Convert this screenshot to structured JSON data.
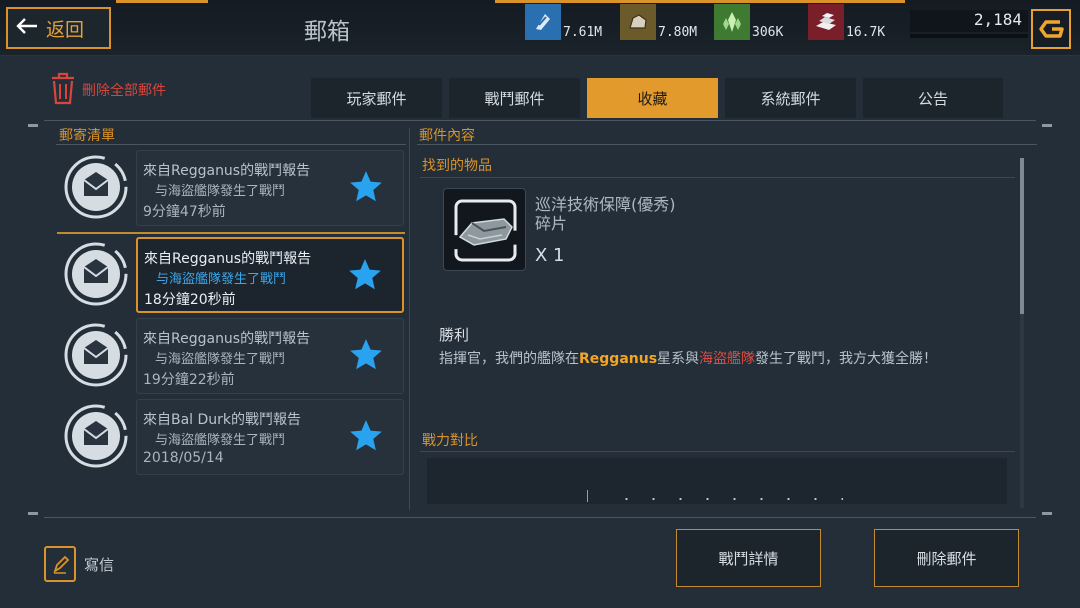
{
  "header": {
    "back_label": "返回",
    "title": "郵箱",
    "resources": [
      {
        "icon": "crystal-shard-icon",
        "value": "7.61M",
        "color": "#2a6fb0"
      },
      {
        "icon": "ore-rock-icon",
        "value": "7.80M",
        "color": "#6b5a2a"
      },
      {
        "icon": "green-crystal-icon",
        "value": "306K",
        "color": "#3f7a32"
      },
      {
        "icon": "gold-bars-icon",
        "value": "16.7K",
        "color": "#7a1f2a"
      }
    ],
    "credits": "2,184"
  },
  "delete_all_label": "刪除全部郵件",
  "tabs": [
    {
      "label": "玩家郵件",
      "active": false
    },
    {
      "label": "戰鬥郵件",
      "active": false
    },
    {
      "label": "收藏",
      "active": true
    },
    {
      "label": "系統郵件",
      "active": false
    },
    {
      "label": "公告",
      "active": false
    }
  ],
  "mail_list": {
    "title": "郵寄清單",
    "items": [
      {
        "line1": "來自Regganus的戰鬥報告",
        "line2": "与海盜艦隊發生了戰鬥",
        "time": "9分鐘47秒前",
        "selected": false
      },
      {
        "line1": "來自Regganus的戰鬥報告",
        "line2": "与海盜艦隊發生了戰鬥",
        "time": "18分鐘20秒前",
        "selected": true
      },
      {
        "line1": "來自Regganus的戰鬥報告",
        "line2": "与海盜艦隊發生了戰鬥",
        "time": "19分鐘22秒前",
        "selected": false
      },
      {
        "line1": "來自Bal Durk的戰鬥報告",
        "line2": "与海盜艦隊發生了戰鬥",
        "time": "2018/05/14",
        "selected": false
      }
    ]
  },
  "mail_content": {
    "title": "郵件內容",
    "found_items_label": "找到的物品",
    "item_name_line1": "巡洋技術保障(優秀)",
    "item_name_line2": "碎片",
    "item_qty": "X 1",
    "victory_title": "勝利",
    "victory_text_1": "指揮官，我們的艦隊在",
    "victory_place": "Regganus",
    "victory_text_2": "星系與",
    "victory_enemy": "海盜艦隊",
    "victory_text_3": "發生了戰鬥，我方大獲全勝！",
    "power_compare_label": "戰力對比"
  },
  "footer": {
    "write_label": "寫信",
    "battle_details_label": "戰鬥詳情",
    "delete_mail_label": "刪除郵件"
  },
  "colors": {
    "accent": "#d9932a",
    "star": "#29a3f0",
    "danger": "#d8453b"
  }
}
